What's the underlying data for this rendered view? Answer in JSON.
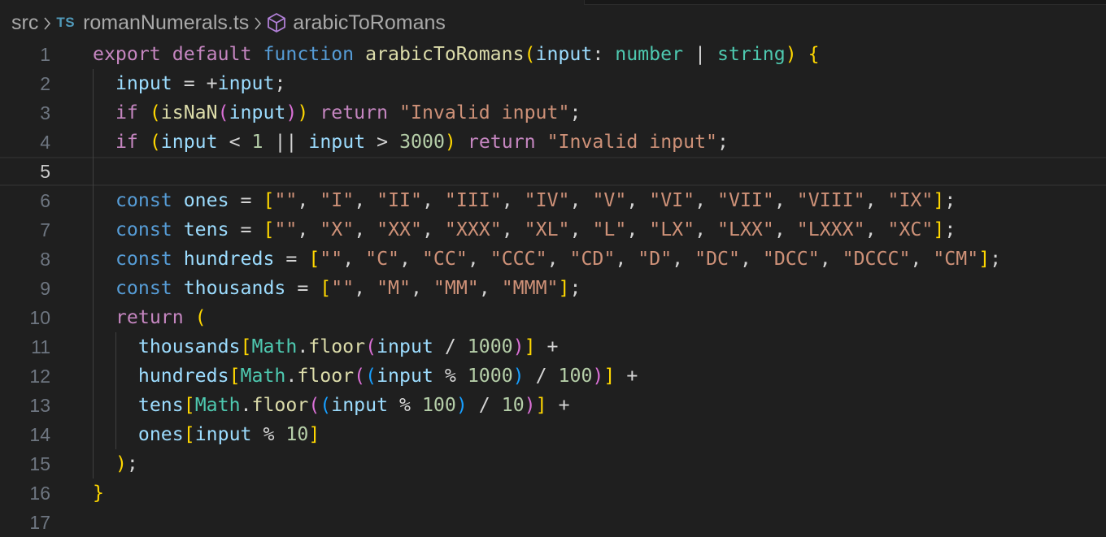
{
  "breadcrumb": {
    "folder": "src",
    "file_type_badge": "TS",
    "file": "romanNumerals.ts",
    "symbol_icon": "cube-icon",
    "symbol": "arabicToRomans"
  },
  "editor": {
    "active_line": 5,
    "line_numbers": [
      "1",
      "2",
      "3",
      "4",
      "5",
      "6",
      "7",
      "8",
      "9",
      "10",
      "11",
      "12",
      "13",
      "14",
      "15",
      "16",
      "17"
    ],
    "lines": [
      "export default function arabicToRomans(input: number | string) {",
      "  input = +input;",
      "  if (isNaN(input)) return \"Invalid input\";",
      "  if (input < 1 || input > 3000) return \"Invalid input\";",
      "",
      "  const ones = [\"\", \"I\", \"II\", \"III\", \"IV\", \"V\", \"VI\", \"VII\", \"VIII\", \"IX\"];",
      "  const tens = [\"\", \"X\", \"XX\", \"XXX\", \"XL\", \"L\", \"LX\", \"LXX\", \"LXXX\", \"XC\"];",
      "  const hundreds = [\"\", \"C\", \"CC\", \"CCC\", \"CD\", \"D\", \"DC\", \"DCC\", \"DCCC\", \"CM\"];",
      "  const thousands = [\"\", \"M\", \"MM\", \"MMM\"];",
      "  return (",
      "    thousands[Math.floor(input / 1000)] +",
      "    hundreds[Math.floor((input % 1000) / 100)] +",
      "    tens[Math.floor((input % 100) / 10)] +",
      "    ones[input % 10]",
      "  );",
      "}",
      ""
    ]
  },
  "colors": {
    "background": "#1f1f1f",
    "keyword_control": "#c586c0",
    "keyword": "#569cd6",
    "function": "#dcdcaa",
    "variable": "#9cdcfe",
    "type": "#4ec9b0",
    "string": "#ce9178",
    "number": "#b5cea8",
    "bracket_level1": "#ffd700",
    "bracket_level2": "#da70d6",
    "bracket_level3": "#179fff"
  }
}
